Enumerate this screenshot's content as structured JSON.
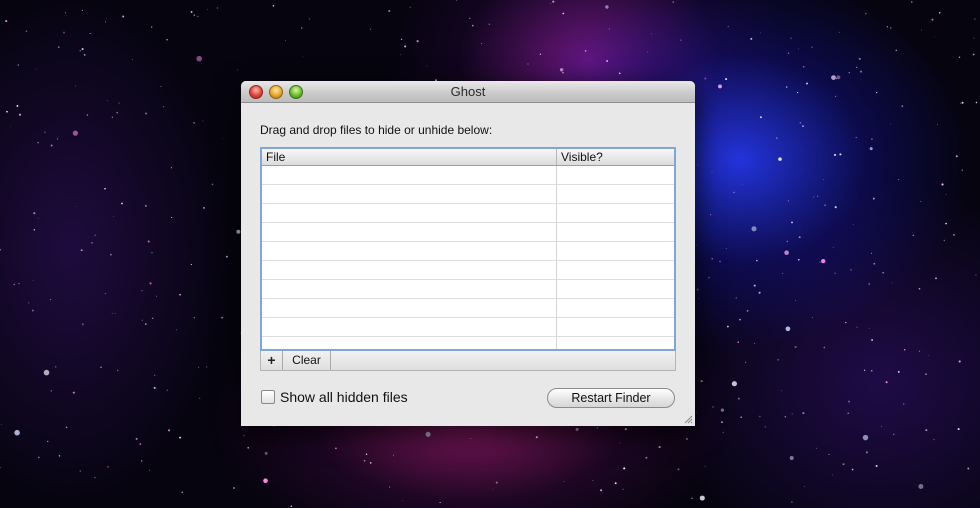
{
  "window": {
    "title": "Ghost"
  },
  "instructions": "Drag and drop files to hide or unhide below:",
  "table": {
    "columns": [
      "File",
      "Visible?"
    ],
    "empty_rows": 10
  },
  "toolbar": {
    "add_label": "+",
    "clear_label": "Clear"
  },
  "options": {
    "show_hidden_label": "Show all hidden files",
    "show_hidden_checked": false
  },
  "actions": {
    "restart_finder_label": "Restart Finder"
  },
  "colors": {
    "table_focus_ring": "#7ea6d9",
    "window_background": "#e8e8e8",
    "close": "#e0443a",
    "minimize": "#e7a52a",
    "zoom": "#6cbc2a"
  }
}
